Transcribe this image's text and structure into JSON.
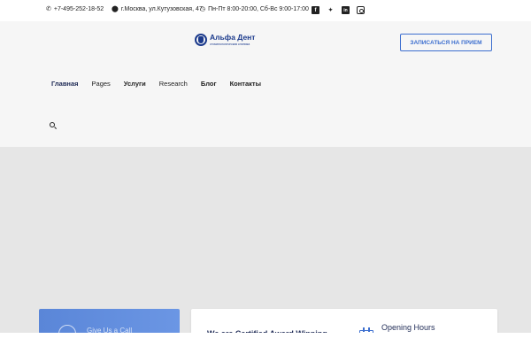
{
  "topbar": {
    "phone": "+7-495-252-18-52",
    "phone_icon": "phone-icon",
    "address": "г.Москва, ул.Кутузовская, 47",
    "address_icon": "map-pin-icon",
    "hours": "Пн-Пт 8:00-20:00, Сб-Вс 9:00-17:00",
    "hours_icon": "clock-icon",
    "social": [
      "facebook-icon",
      "twitter-icon",
      "linkedin-icon",
      "instagram-icon"
    ]
  },
  "header": {
    "logo_title": "Альфа Дент",
    "logo_subtitle": "стоматологическая клиника",
    "appointment_button": "ЗАПИСАТЬСЯ НА ПРИЕМ",
    "accent_color": "#3d6fcf"
  },
  "nav": {
    "items": [
      {
        "label": "Главная"
      },
      {
        "label": "Pages"
      },
      {
        "label": "Услуги"
      },
      {
        "label": "Research"
      },
      {
        "label": "Блог"
      },
      {
        "label": "Контакты"
      }
    ]
  },
  "cards": {
    "call_text": "Give Us a Call",
    "certified_text": "We are Certified Award Winning",
    "opening_hours": "Opening Hours"
  }
}
